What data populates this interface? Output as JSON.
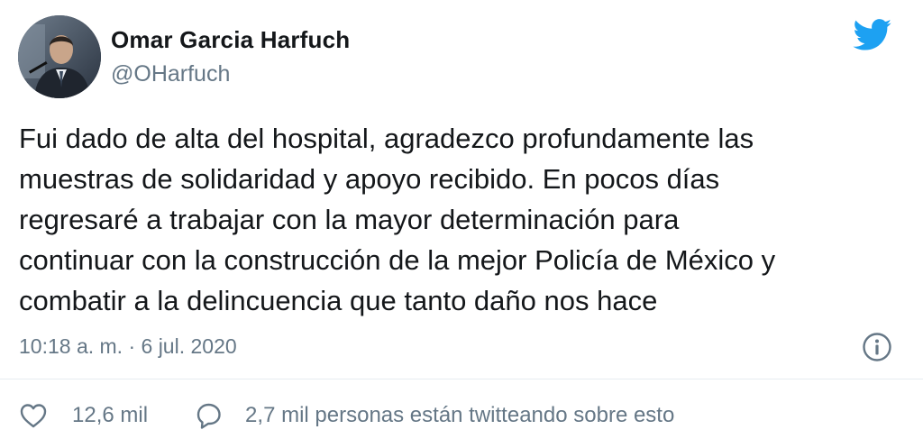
{
  "author": {
    "display_name": "Omar Garcia Harfuch",
    "handle": "@OHarfuch"
  },
  "tweet": {
    "lines": [
      "Fui dado de alta del hospital, agradezco profundamente las",
      "muestras de solidaridad y apoyo recibido. En pocos días",
      "regresaré a trabajar con la mayor determinación para",
      "continuar con la construcción de la mejor Policía de México y",
      "combatir a la delincuencia que tanto daño nos hace"
    ],
    "timestamp": "10:18 a. m. · 6 jul. 2020"
  },
  "actions": {
    "like_count": "12,6 mil",
    "conversation_text": "2,7 mil personas están twitteando sobre esto"
  },
  "icons": {
    "brand": "twitter-bird-icon",
    "info": "info-icon",
    "like": "heart-icon",
    "conversation": "speech-bubble-icon"
  },
  "colors": {
    "brand_blue": "#1da1f2",
    "text_primary": "#14171a",
    "text_secondary": "#657786"
  }
}
